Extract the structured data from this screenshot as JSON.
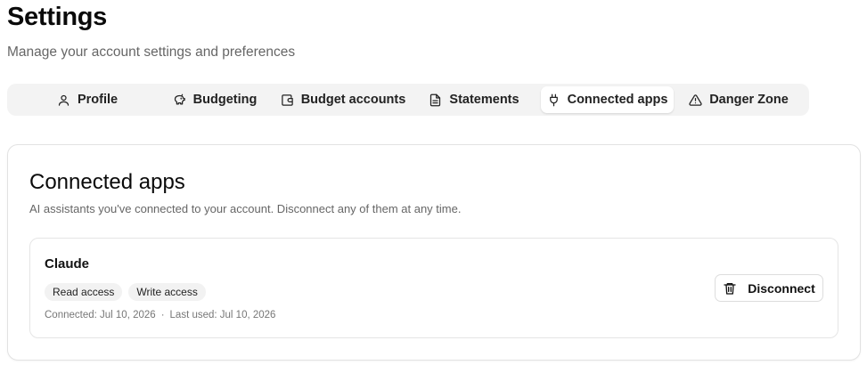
{
  "header": {
    "title": "Settings",
    "subtitle": "Manage your account settings and preferences"
  },
  "tabs": [
    {
      "label": "Profile",
      "icon": "user-icon",
      "active": false
    },
    {
      "label": "Budgeting",
      "icon": "piggy-bank-icon",
      "active": false
    },
    {
      "label": "Budget accounts",
      "icon": "wallet-icon",
      "active": false
    },
    {
      "label": "Statements",
      "icon": "document-icon",
      "active": false
    },
    {
      "label": "Connected apps",
      "icon": "plug-icon",
      "active": true
    },
    {
      "label": "Danger Zone",
      "icon": "warning-triangle-icon",
      "active": false
    }
  ],
  "connected_apps": {
    "title": "Connected apps",
    "description": "AI assistants you've connected to your account. Disconnect any of them at any time.",
    "apps": [
      {
        "name": "Claude",
        "permissions": [
          "Read access",
          "Write access"
        ],
        "connected": "Connected: Jul 10, 2026",
        "separator": "·",
        "last_used": "Last used: Jul 10, 2026",
        "disconnect_label": "Disconnect",
        "disconnect_icon": "trash-icon"
      }
    ]
  },
  "colors": {
    "tab_bar_bg": "#f3f3f3",
    "active_tab_bg": "#ffffff",
    "muted_text": "#666666",
    "border": "#e2e2e2"
  }
}
